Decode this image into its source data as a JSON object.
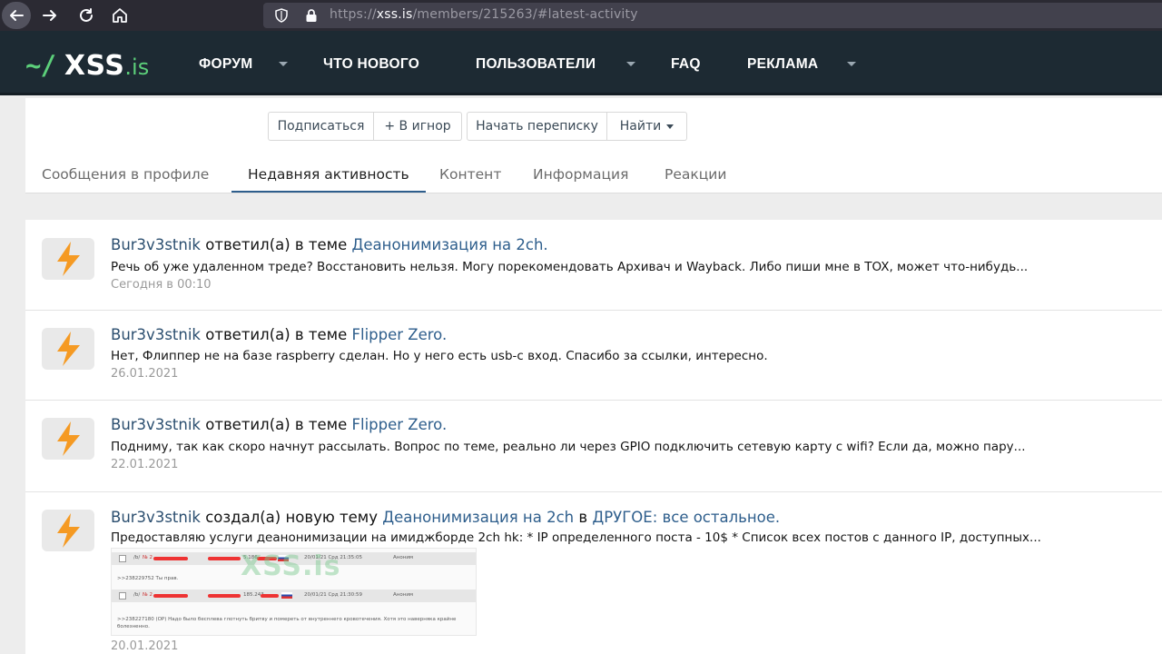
{
  "browser": {
    "url_scheme": "https://",
    "url_host": "xss.is",
    "url_path": "/members/215263/#latest-activity",
    "icons": [
      "back-arrow-icon",
      "forward-arrow-icon",
      "reload-icon",
      "home-icon",
      "shield-icon",
      "lock-icon"
    ]
  },
  "header": {
    "logo_prefix": "~/",
    "logo_main": "XSS",
    "logo_suffix": ".is",
    "menu": [
      {
        "label": "ФОРУМ",
        "has_dropdown": true
      },
      {
        "label": "ЧТО НОВОГО",
        "has_dropdown": false
      },
      {
        "label": "ПОЛЬЗОВАТЕЛИ",
        "has_dropdown": true
      },
      {
        "label": "FAQ",
        "has_dropdown": false
      },
      {
        "label": "РЕКЛАМА",
        "has_dropdown": true
      }
    ]
  },
  "profile": {
    "buttons": {
      "follow": "Подписаться",
      "ignore": "+ В игнор",
      "start_conversation": "Начать переписку",
      "find": "Найти"
    },
    "tabs": [
      {
        "label": "Сообщения в профиле",
        "active": false
      },
      {
        "label": "Недавняя активность",
        "active": true
      },
      {
        "label": "Контент",
        "active": false
      },
      {
        "label": "Информация",
        "active": false
      },
      {
        "label": "Реакции",
        "active": false
      }
    ]
  },
  "activity": [
    {
      "user": "Bur3v3stnik",
      "action": "ответил(а) в теме",
      "thread": "Деанонимизация на 2ch.",
      "snippet": "Речь об уже удаленном треде? Восстановить нельзя. Могу порекомендовать Архивач и Wayback. Либо пиши мне в TOX, может что-нибудь...",
      "time": "Сегодня в 00:10"
    },
    {
      "user": "Bur3v3stnik",
      "action": "ответил(а) в теме",
      "thread": "Flipper Zero.",
      "snippet": "Нет, Флиппер не на базе raspberry сделан. Но у него есть usb-c вход. Спасибо за ссылки, интересно.",
      "time": "26.01.2021"
    },
    {
      "user": "Bur3v3stnik",
      "action": "ответил(а) в теме",
      "thread": "Flipper Zero.",
      "snippet": "Подниму, так как скоро начнут рассылать. Вопрос по теме, реально ли через GPIO подключить сетевую карту с wifi? Если да, можно пару...",
      "time": "22.01.2021"
    },
    {
      "user": "Bur3v3stnik",
      "action": "создал(а) новую тему",
      "thread": "Деанонимизация на 2ch",
      "connector": "в",
      "forum": "ДРУГОЕ: все остальное.",
      "snippet": "Предоставляю услуги деанонимизации на имиджборде 2ch hk: * IP определенного поста - 10$ * Список всех постов с данного IP, доступных...",
      "time": "20.01.2021",
      "thumbnail": {
        "watermark": "XSS.is",
        "row1_board": "/b/",
        "row1_no": "№ 2",
        "row1_ip": "5.186",
        "row1_date": "20/01/21 Срд 21:35:05",
        "row1_name": "Аноним",
        "reply1": ">>238229752 Ты прав.",
        "row2_board": "/b/",
        "row2_no": "№ 2",
        "row2_ip": "185.243",
        "row2_date": "20/01/21 Срд 21:30:59",
        "row2_name": "Аноним",
        "reply2": ">>238227180 (OP) Надо было бесплева глотнуть бритву и помереть от внутреннего кровотечения. Хотя это наверняка крайне болезненно."
      }
    }
  ],
  "colors": {
    "header_bg": "#1d2a33",
    "logo_accent": "#5ccf7a",
    "link": "#2e5e8c",
    "avatar_bolt": "#f59a23",
    "active_tab_underline": "#2e5e8c"
  }
}
